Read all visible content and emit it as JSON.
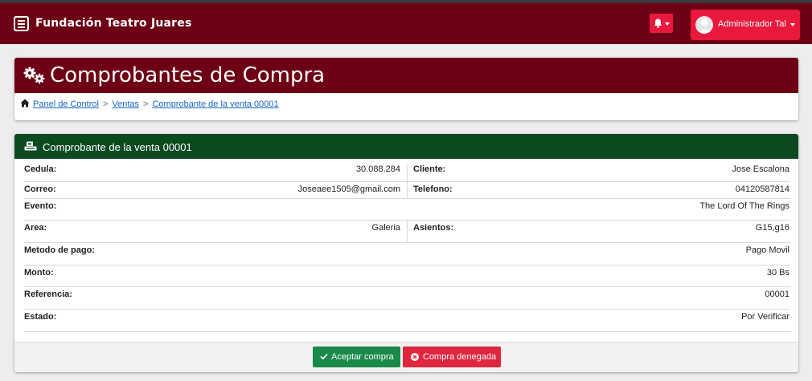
{
  "navbar": {
    "brand": "Fundación Teatro Juares",
    "user_name": "Administrador Tal",
    "menu_icon": "hamburger-menu-icon",
    "notification_icon": "bell-icon",
    "colors": {
      "navbar": "#6e0015",
      "accent": "#e8193c"
    }
  },
  "header": {
    "title": "Comprobantes de Compra",
    "icon": "gears-icon"
  },
  "breadcrumb": {
    "icon": "home-icon",
    "items": [
      "Panel de Control",
      "Ventas",
      "Comprobante de la venta 00001"
    ],
    "separator": ">"
  },
  "receipt": {
    "title": "Comprobante de la venta 00001",
    "header_color": "#0b4a20",
    "fields": {
      "cedula": {
        "label": "Cedula:",
        "value": "30.088.284"
      },
      "cliente": {
        "label": "Cliente:",
        "value": "Jose Escalona"
      },
      "correo": {
        "label": "Correo:",
        "value": "Joseaee1505@gmail.com"
      },
      "telefono": {
        "label": "Telefono:",
        "value": "04120587814"
      },
      "evento": {
        "label": "Evento:",
        "value": "The Lord Of The Rings"
      },
      "area": {
        "label": "Area:",
        "value": "Galeria"
      },
      "asientos": {
        "label": "Asientos:",
        "value": "G15,g16"
      },
      "metodo_pago": {
        "label": "Metodo de pago:",
        "value": "Pago Movil"
      },
      "monto": {
        "label": "Monto:",
        "value": "30 Bs"
      },
      "referencia": {
        "label": "Referencia:",
        "value": "00001"
      },
      "estado": {
        "label": "Estado:",
        "value": "Por Verificar"
      }
    }
  },
  "actions": {
    "accept_label": "Aceptar compra",
    "deny_label": "Compra denegada",
    "accept_color": "#1a8a4b",
    "deny_color": "#e0263f"
  }
}
